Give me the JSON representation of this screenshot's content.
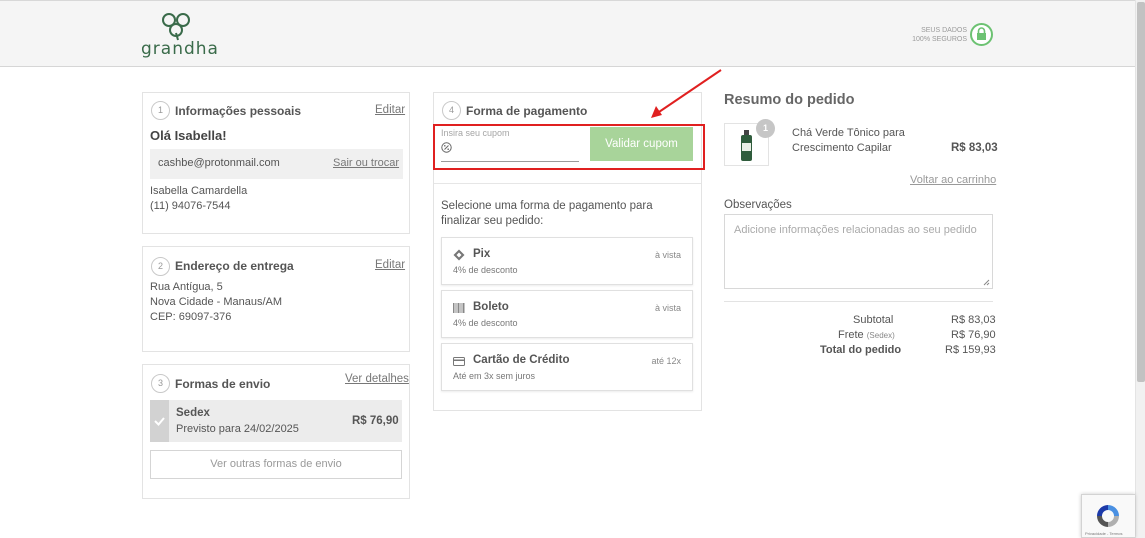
{
  "header": {
    "brand": "grandha",
    "secure_line1": "SEUS DADOS",
    "secure_line2": "100% SEGUROS"
  },
  "personal": {
    "step": "1",
    "title": "Informações pessoais",
    "edit": "Editar",
    "greeting": "Olá Isabella!",
    "email": "cashbe@protonmail.com",
    "switch": "Sair ou trocar",
    "name": "Isabella Camardella",
    "phone": "(11) 94076-7544"
  },
  "address": {
    "step": "2",
    "title": "Endereço de entrega",
    "edit": "Editar",
    "line1": "Rua Antígua, 5",
    "line2": "Nova Cidade - Manaus/AM",
    "line3": "CEP: 69097-376"
  },
  "shipping": {
    "step": "3",
    "title": "Formas de envio",
    "details": "Ver detalhes",
    "method": "Sedex",
    "eta": "Previsto para 24/02/2025",
    "price": "R$ 76,90",
    "other": "Ver outras formas de envio"
  },
  "payment": {
    "step": "4",
    "title": "Forma de pagamento",
    "coupon_placeholder": "Insira seu cupom",
    "coupon_button": "Validar cupom",
    "instruction": "Selecione uma forma de pagamento para finalizar seu pedido:",
    "options": [
      {
        "title": "Pix",
        "right": "à vista",
        "sub": "4% de desconto",
        "icon": "pix-icon"
      },
      {
        "title": "Boleto",
        "right": "à vista",
        "sub": "4% de desconto",
        "icon": "barcode-icon"
      },
      {
        "title": "Cartão de Crédito",
        "right": "até 12x",
        "sub": "Até em 3x sem juros",
        "icon": "credit-card-icon"
      }
    ]
  },
  "summary": {
    "title": "Resumo do pedido",
    "qty": "1",
    "product_name": "Chá Verde Tônico para Crescimento Capilar",
    "product_price": "R$ 83,03",
    "back_to_cart": "Voltar ao carrinho",
    "obs_label": "Observações",
    "obs_placeholder": "Adicione informações relacionadas ao seu pedido",
    "subtotal_label": "Subtotal",
    "subtotal_value": "R$ 83,03",
    "frete_label": "Frete",
    "frete_method": "(Sedex)",
    "frete_value": "R$ 76,90",
    "total_label": "Total do pedido",
    "total_value": "R$ 159,93"
  },
  "recaptcha": {
    "links": "Privacidade - Termos"
  },
  "colors": {
    "brand_green": "#3a6b4a",
    "coupon_button": "#a8d49a",
    "annotation_red": "#e02020"
  }
}
